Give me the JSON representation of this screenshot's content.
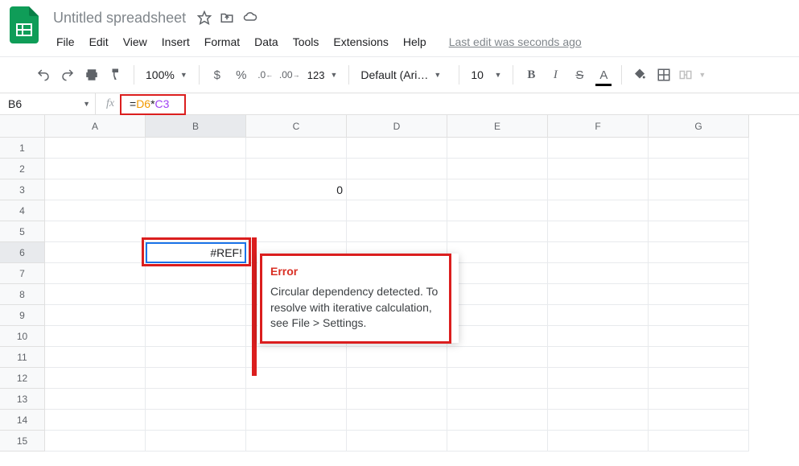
{
  "header": {
    "title": "Untitled spreadsheet"
  },
  "menubar": [
    "File",
    "Edit",
    "View",
    "Insert",
    "Format",
    "Data",
    "Tools",
    "Extensions",
    "Help"
  ],
  "last_edit": "Last edit was seconds ago",
  "toolbar": {
    "zoom": "100%",
    "font": "Default (Ari…",
    "font_size": "10",
    "num_format": "123"
  },
  "formula_bar": {
    "name_box": "B6",
    "formula_prefix": "=",
    "ref1": "D6",
    "op": "*",
    "ref2": "C3"
  },
  "columns": [
    "A",
    "B",
    "C",
    "D",
    "E",
    "F",
    "G"
  ],
  "selected_col_index": 1,
  "rows": [
    1,
    2,
    3,
    4,
    5,
    6,
    7,
    8,
    9,
    10,
    11,
    12,
    13,
    14,
    15
  ],
  "selected_row_index": 5,
  "cells": {
    "C3": "0",
    "B6": "#REF!"
  },
  "error_tooltip": {
    "title": "Error",
    "body": "Circular dependency detected. To resolve with iterative calculation, see File > Settings."
  }
}
